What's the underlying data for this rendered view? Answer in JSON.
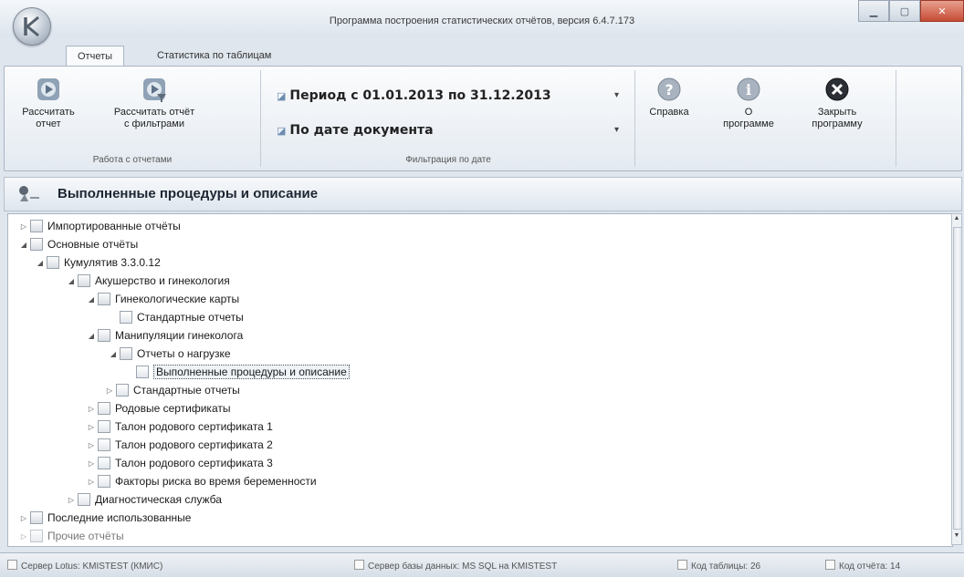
{
  "window": {
    "title": "Программа построения статистических отчётов, версия 6.4.7.173"
  },
  "tabs": [
    {
      "label": "Отчеты"
    },
    {
      "label": "Статистика по таблицам"
    }
  ],
  "ribbon": {
    "reports_group": {
      "calc_label": "Рассчитать\nотчет",
      "calc_filter_label": "Рассчитать отчёт\nс фильтрами",
      "group_label": "Работа с отчетами"
    },
    "filter_group": {
      "period": "Период с 01.01.2013 по 31.12.2013",
      "date_mode": "По дате документа",
      "group_label": "Фильтрация по дате"
    },
    "help_group": {
      "help_label": "Справка",
      "about_label": "О\nпрограмме",
      "close_label": "Закрыть\nпрограмму"
    }
  },
  "section": {
    "title": "Выполненные процедуры и описание"
  },
  "tree": [
    {
      "label": "Импортированные отчёты",
      "expand": "▷"
    },
    {
      "label": "Основные отчёты",
      "expand": "◢"
    },
    {
      "label": "Кумулятив 3.3.0.12",
      "expand": "◢"
    },
    {
      "label": "Акушерство и гинекология",
      "expand": "◢"
    },
    {
      "label": "Гинекологические карты",
      "expand": "◢"
    },
    {
      "label": "Стандартные отчеты",
      "expand": ""
    },
    {
      "label": "Манипуляции гинеколога",
      "expand": "◢"
    },
    {
      "label": "Отчеты о нагрузке",
      "expand": "◢"
    },
    {
      "label": "Выполненные процедуры и описание",
      "expand": ""
    },
    {
      "label": "Стандартные отчеты",
      "expand": "▷"
    },
    {
      "label": "Родовые сертификаты",
      "expand": "▷"
    },
    {
      "label": "Талон родового сертификата 1",
      "expand": "▷"
    },
    {
      "label": "Талон родового сертификата 2",
      "expand": "▷"
    },
    {
      "label": "Талон родового сертификата 3",
      "expand": "▷"
    },
    {
      "label": "Факторы риска во время беременности",
      "expand": "▷"
    },
    {
      "label": "Диагностическая служба",
      "expand": "▷"
    },
    {
      "label": "Последние использованные",
      "expand": "▷"
    },
    {
      "label": "Прочие отчёты",
      "expand": "▷"
    }
  ],
  "statusbar": {
    "server": "Сервер Lotus: KMISTEST (КМИС)",
    "db_server": "Сервер базы данных: MS SQL на KMISTEST",
    "table_code": "Код таблицы: 26",
    "report_code": "Код отчёта: 14"
  }
}
